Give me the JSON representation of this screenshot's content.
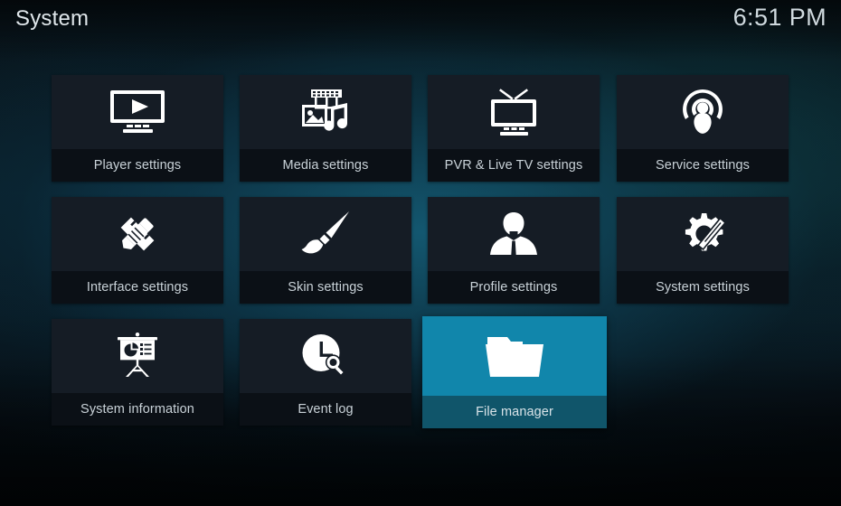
{
  "header": {
    "title": "System",
    "clock": "6:51 PM"
  },
  "theme": {
    "accent": "#1186ab",
    "accent_label": "#10556a",
    "tile_bg": "#151c25",
    "tile_label_bg": "#0b1016",
    "text": "#c9d2d8",
    "title_text": "#dfe6ea"
  },
  "grid": {
    "columns": 4,
    "rows": 3,
    "tiles": [
      {
        "id": "player-settings",
        "label": "Player settings",
        "icon": "monitor-play-icon",
        "selected": false
      },
      {
        "id": "media-settings",
        "label": "Media settings",
        "icon": "film-photo-music-icon",
        "selected": false
      },
      {
        "id": "pvr-livetv-settings",
        "label": "PVR & Live TV settings",
        "icon": "tv-antenna-icon",
        "selected": false
      },
      {
        "id": "service-settings",
        "label": "Service settings",
        "icon": "broadcast-person-icon",
        "selected": false
      },
      {
        "id": "interface-settings",
        "label": "Interface settings",
        "icon": "pencil-ruler-icon",
        "selected": false
      },
      {
        "id": "skin-settings",
        "label": "Skin settings",
        "icon": "paintbrush-icon",
        "selected": false
      },
      {
        "id": "profile-settings",
        "label": "Profile settings",
        "icon": "user-bust-icon",
        "selected": false
      },
      {
        "id": "system-settings",
        "label": "System settings",
        "icon": "gear-screwdriver-icon",
        "selected": false
      },
      {
        "id": "system-information",
        "label": "System information",
        "icon": "presentation-chart-icon",
        "selected": false
      },
      {
        "id": "event-log",
        "label": "Event log",
        "icon": "clock-search-icon",
        "selected": false
      },
      {
        "id": "file-manager",
        "label": "File manager",
        "icon": "folder-open-icon",
        "selected": true
      }
    ]
  }
}
